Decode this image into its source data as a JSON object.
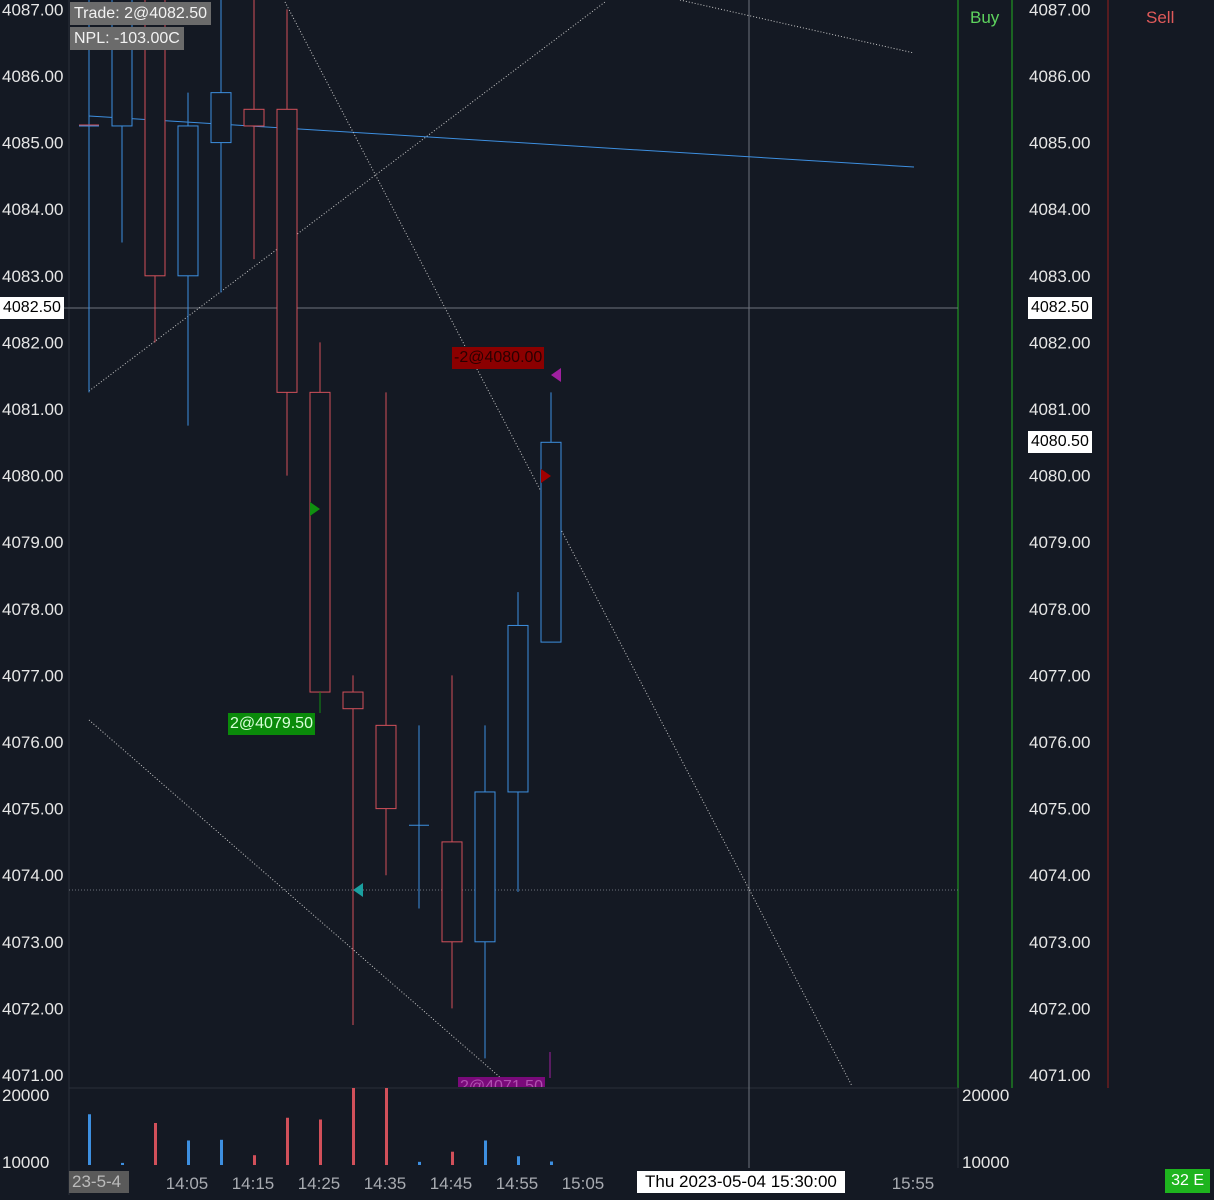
{
  "trade_info": {
    "trade": "Trade: 2@4082.50",
    "npl": "NPL: -103.00C"
  },
  "ladder": {
    "buy_label": "Buy",
    "sell_label": "Sell"
  },
  "cursor": {
    "price_left": "4082.50",
    "time": "Thu 2023-05-04  15:30:00"
  },
  "last_price": "4080.50",
  "status_badge": "32 E",
  "date_stub": "23-5-4",
  "orders": [
    {
      "text": "2@4079.50",
      "kind": "buy-fill"
    },
    {
      "text": "-2@4080.00",
      "kind": "sell-order"
    },
    {
      "text": "2@4071.50",
      "kind": "pending"
    }
  ],
  "colors": {
    "background": "#141923",
    "up": "#3d8fe0",
    "down": "#d2505a",
    "buy": "#008000",
    "sell": "#8b0000",
    "pending": "#8b008b"
  },
  "chart_data": {
    "type": "candlestick",
    "price_ticks": [
      "4087.00",
      "4086.00",
      "4085.00",
      "4084.00",
      "4083.00",
      "4082.00",
      "4081.00",
      "4080.00",
      "4079.00",
      "4078.00",
      "4077.00",
      "4076.00",
      "4075.00",
      "4074.00",
      "4073.00",
      "4072.00",
      "4071.00"
    ],
    "price_ylim": [
      4070.75,
      4087.2
    ],
    "time_ticks": [
      "14:05",
      "14:15",
      "14:25",
      "14:35",
      "14:45",
      "14:55",
      "15:05",
      "15:55"
    ],
    "volume_ticks": [
      "20000",
      "10000"
    ],
    "candles": [
      {
        "time": "13:55",
        "open": 4085.25,
        "high": 4087.25,
        "low": 4081.25,
        "close": 4085.25
      },
      {
        "time": "14:00",
        "open": 4085.25,
        "high": 4087.25,
        "low": 4083.5,
        "close": 4087.25
      },
      {
        "time": "14:05",
        "open": 4087.25,
        "high": 4087.25,
        "low": 4082.0,
        "close": 4083.0
      },
      {
        "time": "14:10",
        "open": 4083.0,
        "high": 4085.75,
        "low": 4080.75,
        "close": 4085.25
      },
      {
        "time": "14:15",
        "open": 4085.0,
        "high": 4087.25,
        "low": 4082.75,
        "close": 4085.75
      },
      {
        "time": "14:20",
        "open": 4085.5,
        "high": 4087.25,
        "low": 4083.25,
        "close": 4085.25
      },
      {
        "time": "14:25",
        "open": 4085.5,
        "high": 4087.0,
        "low": 4080.0,
        "close": 4081.25
      },
      {
        "time": "14:30",
        "open": 4081.25,
        "high": 4082.0,
        "low": 4076.5,
        "close": 4076.75
      },
      {
        "time": "14:35",
        "open": 4076.75,
        "high": 4077.0,
        "low": 4071.75,
        "close": 4076.5
      },
      {
        "time": "14:40",
        "open": 4076.25,
        "high": 4081.25,
        "low": 4074.0,
        "close": 4075.0
      },
      {
        "time": "14:45",
        "open": 4074.75,
        "high": 4076.25,
        "low": 4073.5,
        "close": 4074.75
      },
      {
        "time": "14:50",
        "open": 4074.5,
        "high": 4077.0,
        "low": 4072.0,
        "close": 4073.0
      },
      {
        "time": "14:55",
        "open": 4073.0,
        "high": 4076.25,
        "low": 4071.25,
        "close": 4075.25
      },
      {
        "time": "15:00",
        "open": 4075.25,
        "high": 4078.25,
        "low": 4073.75,
        "close": 4077.75
      },
      {
        "time": "15:05",
        "open": 4077.5,
        "high": 4081.25,
        "low": 4077.5,
        "close": 4080.5
      }
    ],
    "volume": [
      14500,
      600,
      12000,
      7000,
      7200,
      2800,
      13500,
      13000,
      29500,
      29000,
      900,
      3800,
      7000,
      2500,
      1000
    ]
  }
}
